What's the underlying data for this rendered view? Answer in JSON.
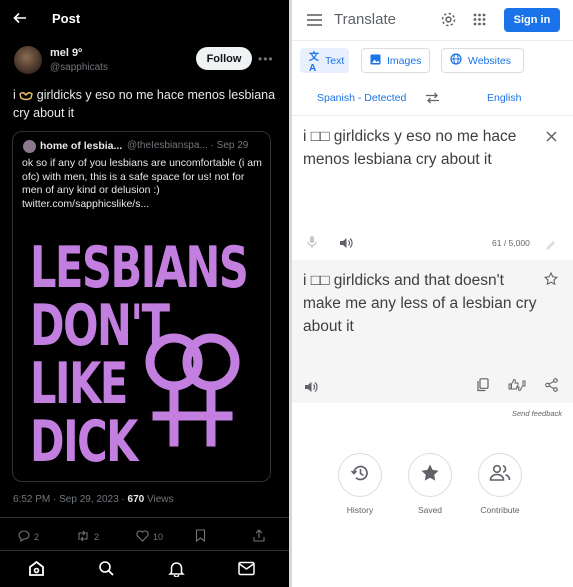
{
  "tweet": {
    "header_title": "Post",
    "author_name": "mel 9º",
    "author_handle": "@sapphicats",
    "follow_label": "Follow",
    "text_prefix": "i",
    "text_rest": "girldicks y eso no me hace menos lesbiana cry about it",
    "quote": {
      "author": "home of lesbia...",
      "handle_time": "@theIesbianspa... · Sep 29",
      "text": "ok so if any of you lesbians are uncomfortable (i am ofc) with men, this is a safe space for us! not for men of any kind or delusion :) twitter.com/sapphicslike/s...",
      "poster_lines": [
        "LESBIANS",
        "DON'T",
        "LIKE",
        "DICK"
      ]
    },
    "timestamp": "6:52 PM · Sep 29, 2023 ·",
    "views_count": "670",
    "views_label": "Views",
    "replies": "2",
    "reposts": "2",
    "likes": "10",
    "colors": {
      "background": "#000000",
      "poster": "#c37fe0"
    }
  },
  "translate": {
    "app_title": "Translate",
    "sign_in_label": "Sign in",
    "modes": [
      "Text",
      "Images",
      "Websites"
    ],
    "source_lang": "Spanish - Detected",
    "target_lang": "English",
    "source_text": "i □□ girldicks y eso no me hace menos lesbiana cry about it",
    "char_count": "61 / 5,000",
    "output_text": "i □□ girldicks and that doesn't make me any less of a lesbian cry about it",
    "send_feedback": "Send feedback",
    "shortcuts": [
      "History",
      "Saved",
      "Contribute"
    ],
    "colors": {
      "accent": "#1a73e8",
      "output_panel": "#f5f5f5"
    }
  }
}
